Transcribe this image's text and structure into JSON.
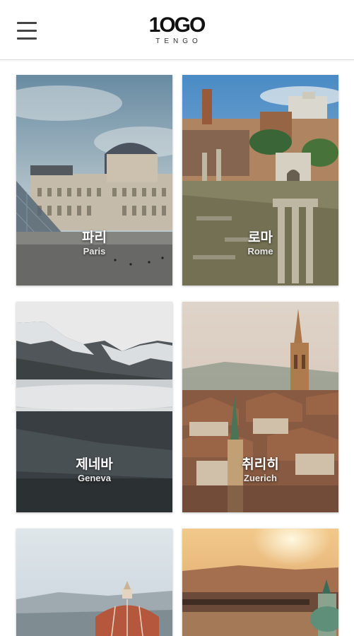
{
  "header": {
    "logo_main": "1OGO",
    "logo_sub": "TENGO",
    "menu_icon": "hamburger-menu-icon"
  },
  "cities": [
    {
      "name_ko": "파리",
      "name_en": "Paris"
    },
    {
      "name_ko": "로마",
      "name_en": "Rome"
    },
    {
      "name_ko": "제네바",
      "name_en": "Geneva"
    },
    {
      "name_ko": "취리히",
      "name_en": "Zuerich"
    },
    {
      "name_ko": "",
      "name_en": ""
    },
    {
      "name_ko": "",
      "name_en": ""
    }
  ]
}
